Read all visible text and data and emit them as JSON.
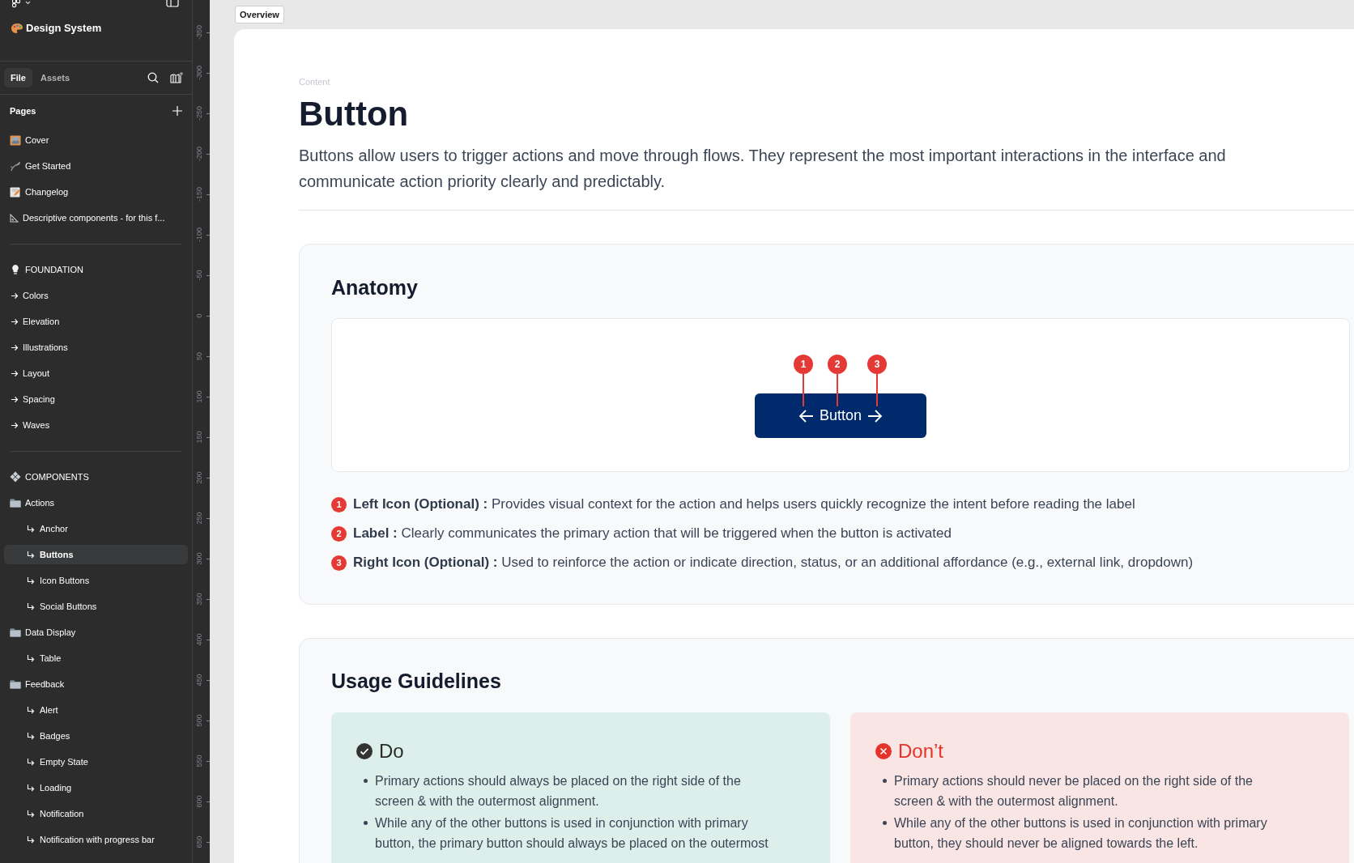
{
  "sidebar": {
    "file_title": "Design System",
    "tabs": [
      {
        "label": "File",
        "selected": true
      },
      {
        "label": "Assets",
        "selected": false
      }
    ],
    "pages_header": "Pages",
    "pages": [
      {
        "label": "Cover",
        "selected": false
      },
      {
        "label": "Get Started",
        "selected": false
      },
      {
        "label": "Changelog",
        "selected": false
      },
      {
        "label": "Descriptive components - for this f...",
        "selected": false
      }
    ],
    "sections": [
      {
        "label": "FOUNDATION",
        "children": [
          {
            "label": "Colors",
            "selected": false
          },
          {
            "label": "Elevation",
            "selected": false
          },
          {
            "label": "Illustrations",
            "selected": false
          },
          {
            "label": "Layout",
            "selected": false
          },
          {
            "label": "Spacing",
            "selected": false
          },
          {
            "label": "Waves",
            "selected": false
          }
        ]
      },
      {
        "label": "COMPONENTS",
        "children": [
          {
            "label": "Actions",
            "selected": false,
            "children": [
              {
                "label": "Anchor",
                "selected": false
              },
              {
                "label": "Buttons",
                "selected": true
              },
              {
                "label": "Icon Buttons",
                "selected": false
              },
              {
                "label": "Social Buttons",
                "selected": false
              }
            ]
          },
          {
            "label": "Data Display",
            "selected": false,
            "children": [
              {
                "label": "Table",
                "selected": false
              }
            ]
          },
          {
            "label": "Feedback",
            "selected": false,
            "children": [
              {
                "label": "Alert",
                "selected": false
              },
              {
                "label": "Badges",
                "selected": false
              },
              {
                "label": "Empty State",
                "selected": false
              },
              {
                "label": "Loading",
                "selected": false
              },
              {
                "label": "Notification",
                "selected": false
              },
              {
                "label": "Notification with progress bar",
                "selected": false
              }
            ]
          }
        ]
      }
    ]
  },
  "ruler": {
    "ticks": [
      "-350",
      "-300",
      "-250",
      "-200",
      "-150",
      "-100",
      "-50",
      "0",
      "50",
      "100",
      "150",
      "200",
      "250",
      "300",
      "350",
      "400",
      "450",
      "500",
      "550",
      "600",
      "650"
    ]
  },
  "canvas": {
    "frame_tag": "Overview",
    "eyebrow": "Content",
    "title": "Button",
    "description": "Buttons allow users to trigger actions and move through flows. They represent the most important interactions in the interface and communicate action priority clearly and predictably.",
    "anatomy": {
      "heading": "Anatomy",
      "button_label": "Button",
      "markers": [
        "1",
        "2",
        "3"
      ],
      "items": [
        {
          "number": "1",
          "text": "**Left Icon (Optional) :** Provides visual context for the action and helps users quickly recognize the intent before reading the label"
        },
        {
          "number": "2",
          "text": "**Label :** Clearly communicates the primary action that will be triggered when the button is activated"
        },
        {
          "number": "3",
          "text": "**Right Icon (Optional) :** Used to reinforce the action or indicate direction, status, or an additional affordance (e.g., external link, dropdown)"
        }
      ]
    },
    "usage": {
      "heading": "Usage Guidelines",
      "cards": [
        {
          "kind": "do",
          "title": "Do",
          "bullets": [
            "Primary actions should always be placed on the right side of the screen & with the outermost alignment.",
            "While any of the other buttons is used in conjunction with primary button, the primary button should always be placed on the outermost"
          ]
        },
        {
          "kind": "dont",
          "title": "Don’t",
          "bullets": [
            "Primary actions should never be placed on the right side of the screen & with the outermost alignment.",
            "While any of the other buttons is used in conjunction with primary button, they should never be aligned towards the left."
          ]
        }
      ]
    }
  }
}
